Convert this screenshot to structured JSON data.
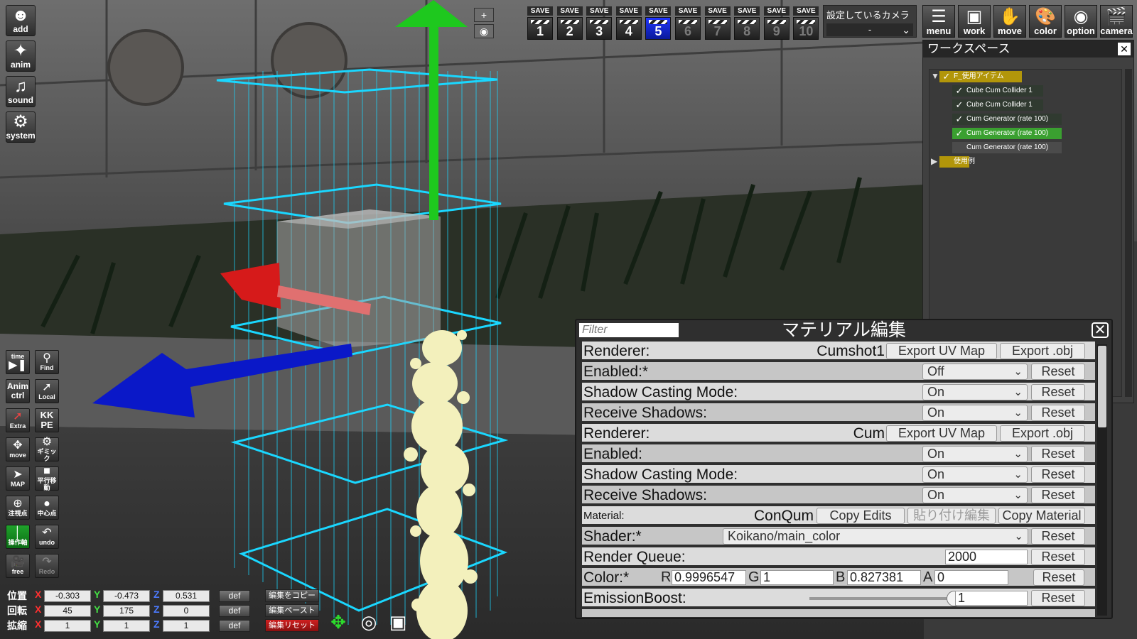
{
  "toolbar_left": {
    "top_buttons": [
      {
        "label": "add",
        "icon": "person-icon"
      },
      {
        "label": "anim",
        "icon": "run-icon"
      },
      {
        "label": "sound",
        "icon": "music-icon"
      },
      {
        "label": "system",
        "icon": "gears-icon"
      }
    ],
    "tool_grid": [
      {
        "label": "time",
        "icon": "play-pause-icon"
      },
      {
        "label": "Find",
        "icon": "magnifier-icon"
      },
      {
        "label": "Anim ctrl",
        "icon": ""
      },
      {
        "label": "Local",
        "icon": "axis-icon"
      },
      {
        "label": "Extra",
        "icon": "axis-color-icon"
      },
      {
        "label": "KK PE",
        "icon": ""
      },
      {
        "label": "move",
        "icon": "move-arrows-icon"
      },
      {
        "label": "ギミック",
        "icon": "gear-icon"
      },
      {
        "label": "MAP",
        "icon": "map-icon"
      },
      {
        "label": "平行移動",
        "icon": "square-icon"
      },
      {
        "label": "注視点",
        "icon": "crosshair-icon"
      },
      {
        "label": "中心点",
        "icon": "circle-icon"
      },
      {
        "label": "操作軸",
        "icon": "axis-icon"
      },
      {
        "label": "undo",
        "icon": "undo-icon"
      },
      {
        "label": "free",
        "icon": "camera-icon"
      },
      {
        "label": "Redo",
        "icon": "redo-icon"
      }
    ]
  },
  "transform": {
    "rows": [
      {
        "label": "位置",
        "x": "-0.303",
        "y": "-0.473",
        "z": "0.531",
        "def": "def"
      },
      {
        "label": "回転",
        "x": "45",
        "y": "175",
        "z": "0",
        "def": "def"
      },
      {
        "label": "拡縮",
        "x": "1",
        "y": "1",
        "z": "1",
        "def": "def"
      }
    ],
    "axis_labels": {
      "x": "X",
      "y": "Y",
      "z": "Z"
    },
    "edit_buttons": [
      "編集をコピー",
      "編集ペースト",
      "編集リセット"
    ]
  },
  "view_controls": {
    "zoom_in": "+",
    "eye": "eye-icon"
  },
  "save_slots": {
    "save_label": "SAVE",
    "slots": [
      "1",
      "2",
      "3",
      "4",
      "5",
      "6",
      "7",
      "8",
      "9",
      "10"
    ],
    "active_index": 4
  },
  "camera_select": {
    "title": "設定しているカメラ",
    "value": "-"
  },
  "top_right_buttons": [
    {
      "label": "menu",
      "icon": "list-icon"
    },
    {
      "label": "work",
      "icon": "window-icon"
    },
    {
      "label": "move",
      "icon": "hand-icon"
    },
    {
      "label": "color",
      "icon": "palette-icon"
    },
    {
      "label": "option",
      "icon": "eye-icon"
    },
    {
      "label": "camera",
      "icon": "clapper-icon"
    }
  ],
  "workspace": {
    "title": "ワークスペース",
    "nodes": [
      {
        "label": "F_使用アイテム",
        "checked": true,
        "type": "folder",
        "expanded": true
      },
      {
        "label": "Cube Cum Collider 1",
        "checked": true,
        "type": "item"
      },
      {
        "label": "Cube Cum Collider 1",
        "checked": true,
        "type": "item"
      },
      {
        "label": "Cum Generator (rate 100)",
        "checked": true,
        "type": "item"
      },
      {
        "label": "Cum Generator (rate 100)",
        "checked": true,
        "type": "selected"
      },
      {
        "label": "Cum Generator (rate 100)",
        "checked": false,
        "type": "child"
      },
      {
        "label": "使用例",
        "checked": false,
        "type": "folder",
        "expanded": false
      }
    ]
  },
  "material_editor": {
    "title": "マテリアル編集",
    "filter_placeholder": "Filter",
    "renderers": [
      {
        "label": "Renderer:",
        "name": "Cumshot1",
        "export_uv": "Export UV Map",
        "export_obj": "Export .obj",
        "props": [
          {
            "label": "Enabled:*",
            "value": "Off",
            "reset": "Reset"
          },
          {
            "label": "Shadow Casting Mode:",
            "value": "On",
            "reset": "Reset"
          },
          {
            "label": "Receive Shadows:",
            "value": "On",
            "reset": "Reset"
          }
        ]
      },
      {
        "label": "Renderer:",
        "name": "Cum",
        "export_uv": "Export UV Map",
        "export_obj": "Export .obj",
        "props": [
          {
            "label": "Enabled:",
            "value": "On",
            "reset": "Reset"
          },
          {
            "label": "Shadow Casting Mode:",
            "value": "On",
            "reset": "Reset"
          },
          {
            "label": "Receive Shadows:",
            "value": "On",
            "reset": "Reset"
          }
        ]
      }
    ],
    "material": {
      "label": "Material:",
      "name": "ConQum",
      "copy_edits": "Copy Edits",
      "paste_edits": "貼り付け編集",
      "copy_material": "Copy Material"
    },
    "shader": {
      "label": "Shader:*",
      "value": "Koikano/main_color",
      "reset": "Reset"
    },
    "render_queue": {
      "label": "Render Queue:",
      "value": "2000",
      "reset": "Reset"
    },
    "color": {
      "label": "Color:*",
      "r_label": "R",
      "r": "0.9996547",
      "g_label": "G",
      "g": "1",
      "b_label": "B",
      "b": "0.827381",
      "a_label": "A",
      "a": "0",
      "reset": "Reset"
    },
    "emission_boost": {
      "label": "EmissionBoost:",
      "value": "1",
      "slider_level": 0.98,
      "reset": "Reset"
    }
  },
  "colors": {
    "accent_blue": "#2035ff",
    "selected_green": "#3aa030",
    "folder_gold": "#b2960a",
    "gizmo_y": "#1ec81e",
    "gizmo_x": "#d61a1a",
    "gizmo_z": "#0a18c8",
    "collider_cyan": "#1ad7ff"
  }
}
